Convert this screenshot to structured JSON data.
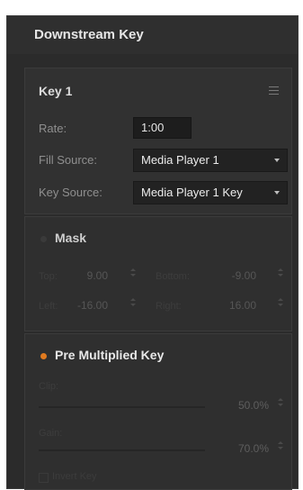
{
  "panel": {
    "title": "Downstream Key"
  },
  "key": {
    "title": "Key 1",
    "menu_icon": "hamburger-menu-icon",
    "rate": {
      "label": "Rate:",
      "value": "1:00"
    },
    "fill_source": {
      "label": "Fill Source:",
      "value": "Media Player 1"
    },
    "key_source": {
      "label": "Key Source:",
      "value": "Media Player 1 Key"
    }
  },
  "mask": {
    "title": "Mask",
    "enabled": false,
    "fields": [
      {
        "label": "Top:",
        "value": "9.00"
      },
      {
        "label": "Bottom:",
        "value": "-9.00"
      },
      {
        "label": "Left:",
        "value": "-16.00"
      },
      {
        "label": "Right:",
        "value": "16.00"
      }
    ]
  },
  "pre_multiplied": {
    "title": "Pre Multiplied Key",
    "enabled": true,
    "accent_color": "#e07a1f",
    "clip": {
      "label": "Clip:",
      "value": "50.0%",
      "level": 0.5
    },
    "gain": {
      "label": "Gain:",
      "value": "70.0%",
      "level": 0.7
    },
    "invert": {
      "label": "Invert Key",
      "checked": false
    }
  }
}
